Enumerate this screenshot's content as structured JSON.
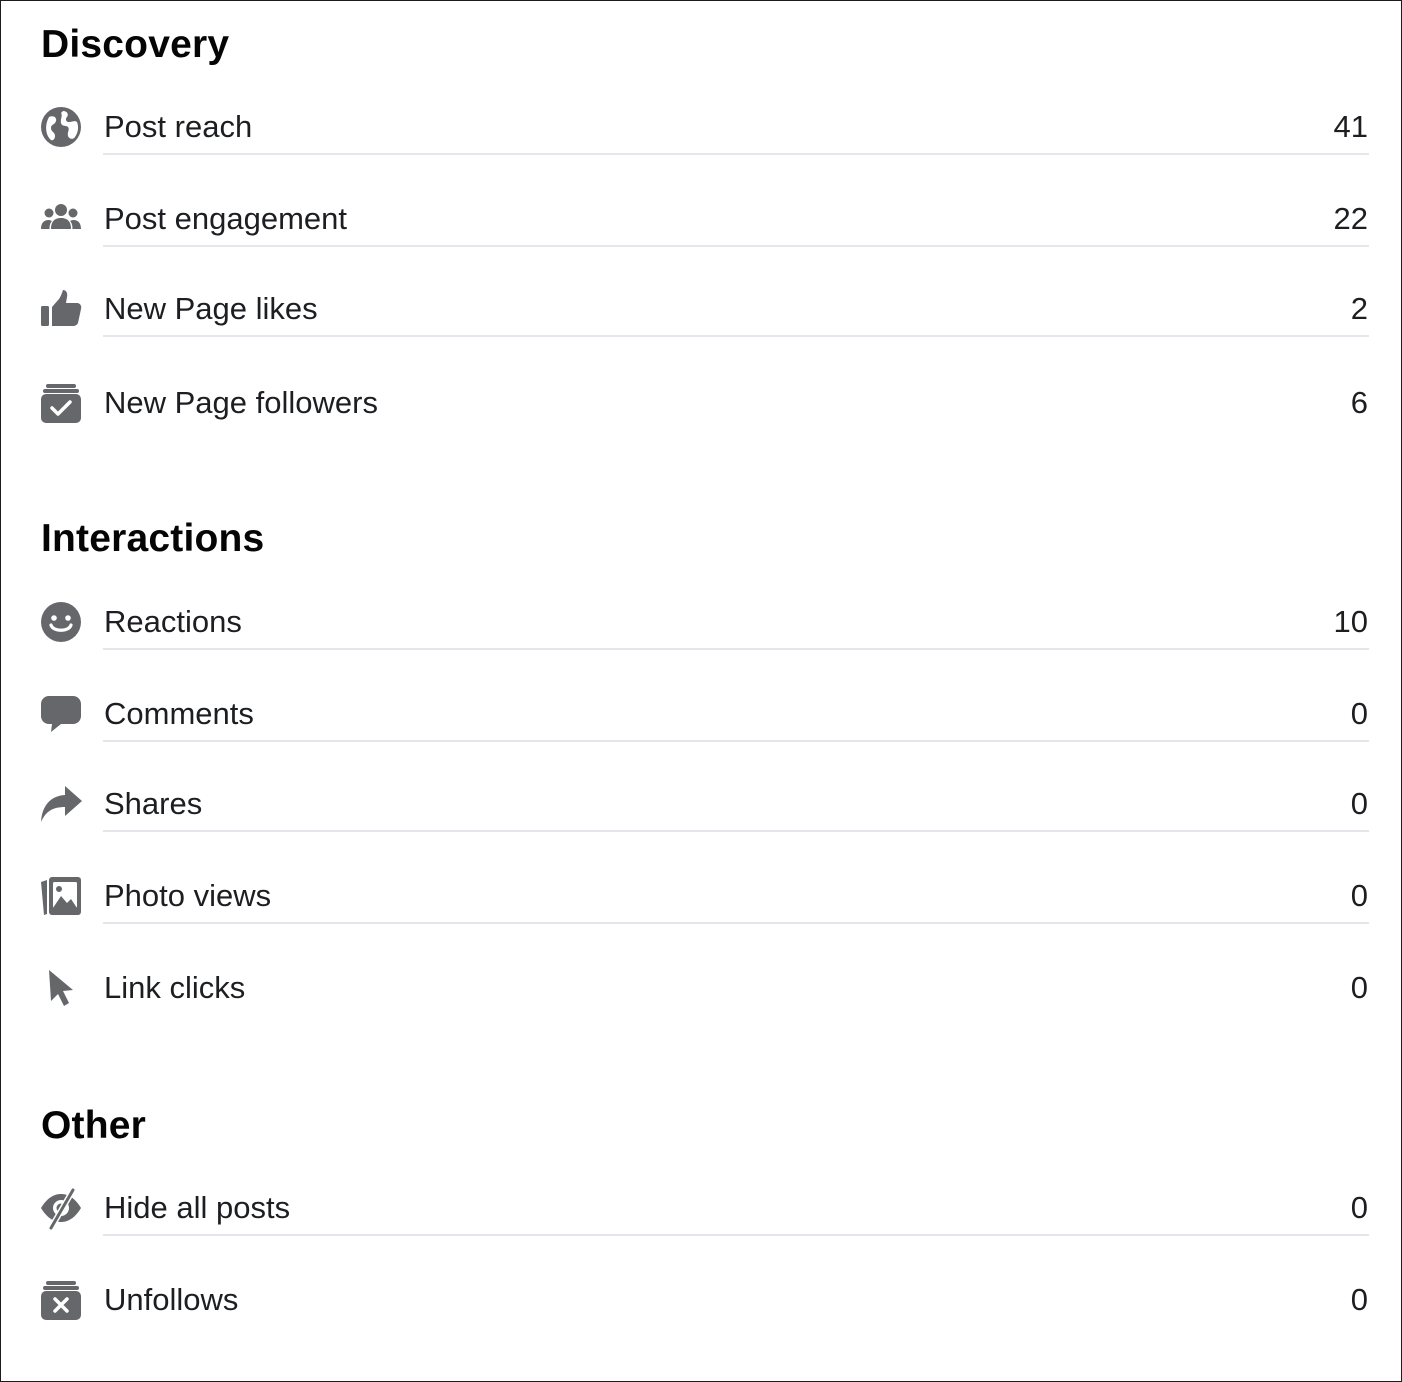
{
  "colors": {
    "icon": "#65676b",
    "divider": "#e4e6eb",
    "text": "#1c1e21"
  },
  "sections": [
    {
      "title": "Discovery",
      "items": [
        {
          "icon": "globe-icon",
          "label": "Post reach",
          "value": "41"
        },
        {
          "icon": "people-icon",
          "label": "Post engagement",
          "value": "22"
        },
        {
          "icon": "thumbs-up-icon",
          "label": "New Page likes",
          "value": "2"
        },
        {
          "icon": "follow-icon",
          "label": "New Page followers",
          "value": "6"
        }
      ]
    },
    {
      "title": "Interactions",
      "items": [
        {
          "icon": "smiley-icon",
          "label": "Reactions",
          "value": "10"
        },
        {
          "icon": "comment-icon",
          "label": "Comments",
          "value": "0"
        },
        {
          "icon": "share-icon",
          "label": "Shares",
          "value": "0"
        },
        {
          "icon": "photo-icon",
          "label": "Photo views",
          "value": "0"
        },
        {
          "icon": "cursor-icon",
          "label": "Link clicks",
          "value": "0"
        }
      ]
    },
    {
      "title": "Other",
      "items": [
        {
          "icon": "eye-slash-icon",
          "label": "Hide all posts",
          "value": "0"
        },
        {
          "icon": "unfollow-icon",
          "label": "Unfollows",
          "value": "0"
        }
      ]
    }
  ]
}
